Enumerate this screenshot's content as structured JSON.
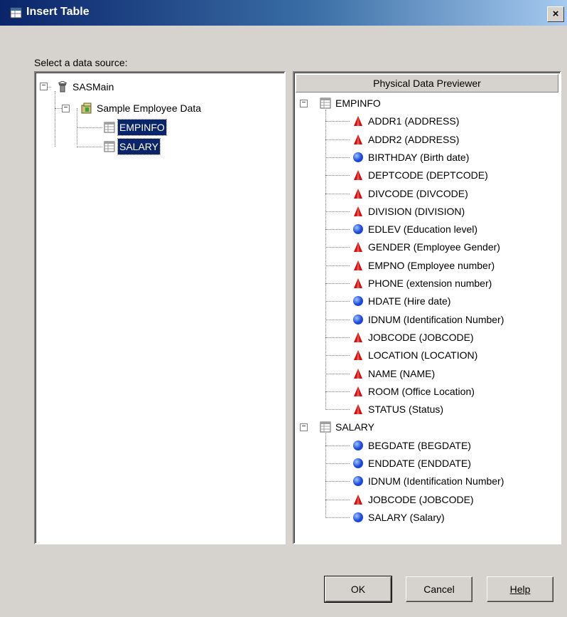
{
  "window": {
    "title": "Insert Table",
    "close_label": "×"
  },
  "source_label": "Select a data source:",
  "left_tree": {
    "root": {
      "label": "SASMain",
      "icon": "server-icon"
    },
    "library": {
      "label": "Sample Employee Data",
      "icon": "library-icon"
    },
    "tables": [
      {
        "label": "EMPINFO",
        "selected": true
      },
      {
        "label": "SALARY",
        "selected": true
      }
    ]
  },
  "previewer": {
    "header": "Physical Data Previewer",
    "tables": [
      {
        "label": "EMPINFO",
        "columns": [
          {
            "label": "ADDR1 (ADDRESS)",
            "type": "char"
          },
          {
            "label": "ADDR2 (ADDRESS)",
            "type": "char"
          },
          {
            "label": "BIRTHDAY (Birth date)",
            "type": "num"
          },
          {
            "label": "DEPTCODE (DEPTCODE)",
            "type": "char"
          },
          {
            "label": "DIVCODE (DIVCODE)",
            "type": "char"
          },
          {
            "label": "DIVISION (DIVISION)",
            "type": "char"
          },
          {
            "label": "EDLEV (Education level)",
            "type": "num"
          },
          {
            "label": "GENDER (Employee Gender)",
            "type": "char"
          },
          {
            "label": "EMPNO (Employee number)",
            "type": "char"
          },
          {
            "label": "PHONE (extension number)",
            "type": "char"
          },
          {
            "label": "HDATE (Hire date)",
            "type": "num"
          },
          {
            "label": "IDNUM (Identification Number)",
            "type": "num"
          },
          {
            "label": "JOBCODE (JOBCODE)",
            "type": "char"
          },
          {
            "label": "LOCATION (LOCATION)",
            "type": "char"
          },
          {
            "label": "NAME (NAME)",
            "type": "char"
          },
          {
            "label": "ROOM (Office Location)",
            "type": "char"
          },
          {
            "label": "STATUS (Status)",
            "type": "char"
          }
        ]
      },
      {
        "label": "SALARY",
        "columns": [
          {
            "label": "BEGDATE (BEGDATE)",
            "type": "num"
          },
          {
            "label": "ENDDATE (ENDDATE)",
            "type": "num"
          },
          {
            "label": "IDNUM (Identification Number)",
            "type": "num"
          },
          {
            "label": "JOBCODE (JOBCODE)",
            "type": "char"
          },
          {
            "label": "SALARY (Salary)",
            "type": "num"
          }
        ]
      }
    ]
  },
  "buttons": {
    "ok": "OK",
    "cancel": "Cancel",
    "help": "Help"
  },
  "colors": {
    "title_start": "#0a246a",
    "title_end": "#a6caf0",
    "char_icon": "#d01010",
    "num_icon": "#1a47d8",
    "selection": "#0a246a"
  }
}
